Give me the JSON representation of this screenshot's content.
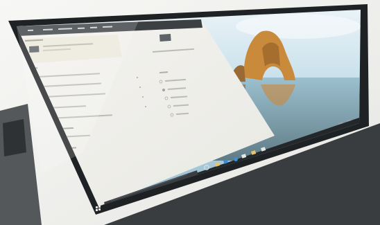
{
  "scene": {
    "description_hidden": "",
    "accent_colors": {
      "ui_panel": "#f2f2ee",
      "desktop_sky": "#a9cde0",
      "rock": "#c8883a",
      "taskbar": "#2a2d31",
      "bezel": "#1c1f22",
      "list_icon_red": "#d9534f",
      "list_icon_orange": "#e8a23a",
      "list_icon_pink": "#d9738c"
    },
    "icons": [
      "cortana-circle-icon",
      "file-explorer-icon",
      "store-icon",
      "edge-icon",
      "mail-icon",
      "windows-start-icon"
    ]
  }
}
